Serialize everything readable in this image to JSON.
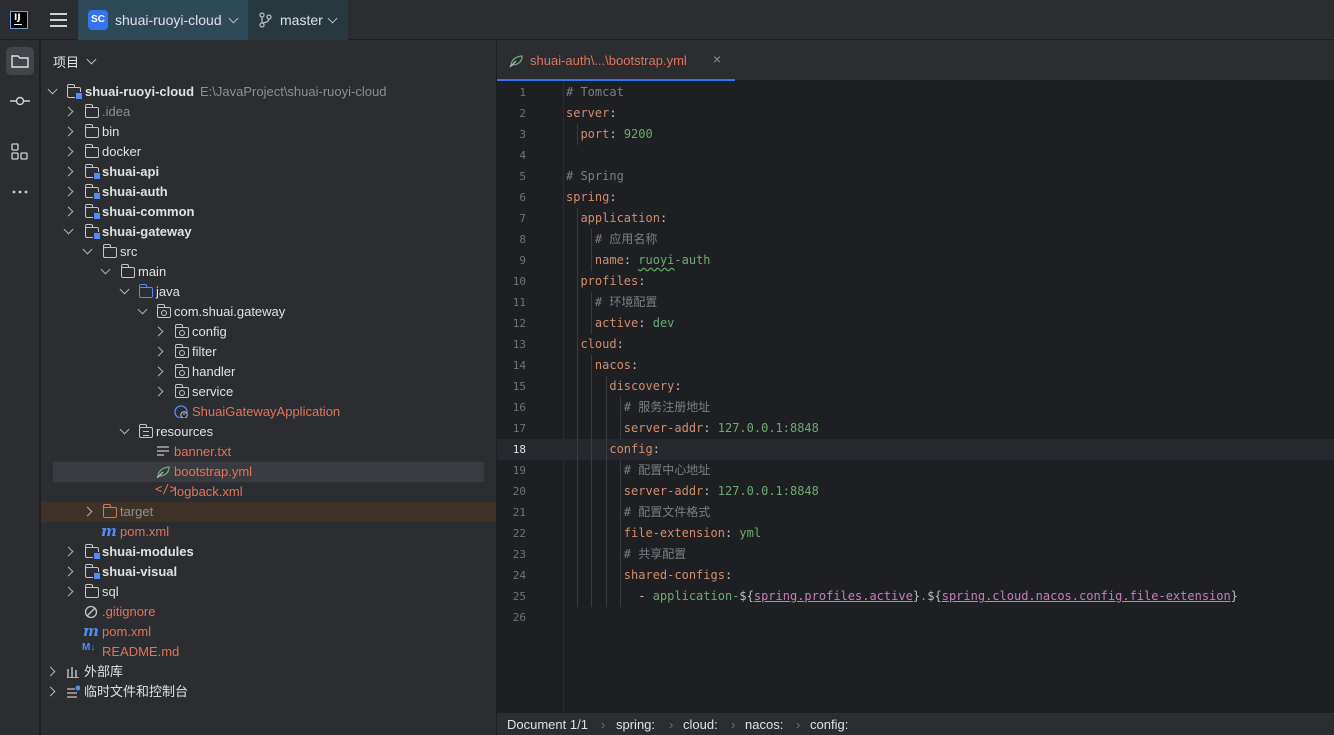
{
  "topbar": {
    "logo_text": "IJ",
    "project_badge": "SC",
    "project_name": "shuai-ruoyi-cloud",
    "branch": "master"
  },
  "toolstrip": {
    "items": [
      "project-folder-icon",
      "commit-icon",
      "structure-icon",
      "more-icon"
    ]
  },
  "project_panel": {
    "header": "项目",
    "tree": [
      {
        "label": "shuai-ruoyi-cloud",
        "path": "E:\\JavaProject\\shuai-ruoyi-cloud"
      },
      {
        "label": ".idea"
      },
      {
        "label": "bin"
      },
      {
        "label": "docker"
      },
      {
        "label": "shuai-api"
      },
      {
        "label": "shuai-auth"
      },
      {
        "label": "shuai-common"
      },
      {
        "label": "shuai-gateway"
      },
      {
        "label": "src"
      },
      {
        "label": "main"
      },
      {
        "label": "java"
      },
      {
        "label": "com.shuai.gateway"
      },
      {
        "label": "config"
      },
      {
        "label": "filter"
      },
      {
        "label": "handler"
      },
      {
        "label": "service"
      },
      {
        "label": "ShuaiGatewayApplication"
      },
      {
        "label": "resources"
      },
      {
        "label": "banner.txt"
      },
      {
        "label": "bootstrap.yml"
      },
      {
        "label": "logback.xml"
      },
      {
        "label": "target"
      },
      {
        "label": "pom.xml"
      },
      {
        "label": "shuai-modules"
      },
      {
        "label": "shuai-visual"
      },
      {
        "label": "sql"
      },
      {
        "label": ".gitignore"
      },
      {
        "label": "pom.xml"
      },
      {
        "label": "README.md"
      },
      {
        "label": "外部库"
      },
      {
        "label": "临时文件和控制台"
      }
    ]
  },
  "editor": {
    "tab_label": "shuai-auth\\...\\bootstrap.yml",
    "close_glyph": "×",
    "current_line": 18,
    "lines": [
      "# Tomcat",
      "server:",
      "  port: 9200",
      "",
      "# Spring",
      "spring:",
      "  application:",
      "    # 应用名称",
      "    name: ruoyi-auth",
      "  profiles:",
      "    # 环境配置",
      "    active: dev",
      "  cloud:",
      "    nacos:",
      "      discovery:",
      "        # 服务注册地址",
      "        server-addr: 127.0.0.1:8848",
      "      config:",
      "        # 配置中心地址",
      "        server-addr: 127.0.0.1:8848",
      "        # 配置文件格式",
      "        file-extension: yml",
      "        # 共享配置",
      "        shared-configs:",
      "          - application-${spring.profiles.active}.${spring.cloud.nacos.config.file-extension}",
      ""
    ]
  },
  "statusbar": {
    "document": "Document 1/1",
    "crumbs": [
      "spring:",
      "cloud:",
      "nacos:",
      "config:"
    ]
  },
  "colors": {
    "accent": "#3574f0",
    "modified_file": "#e0755b",
    "yaml_key": "#cf8e6d",
    "yaml_value": "#6aab73",
    "comment": "#7a7e85"
  }
}
